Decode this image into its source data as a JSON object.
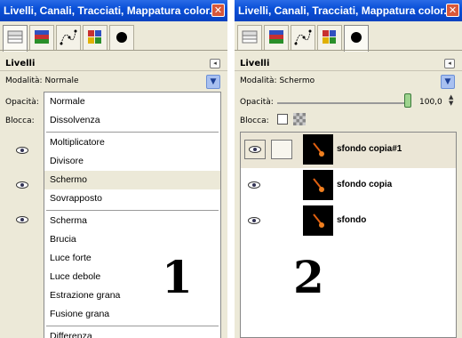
{
  "labels": {
    "panel1_marker": "1",
    "panel2_marker": "2"
  },
  "panel1": {
    "title": "Livelli, Canali, Tracciati, Mappatura color...",
    "section_title": "Livelli",
    "modalita_label": "Modalità:",
    "modalita_value": "Normale",
    "opacita_label": "Opacità:",
    "blocca_label": "Blocca:",
    "dropdown": {
      "items": [
        "Normale",
        "Dissolvenza",
        "Moltiplicatore",
        "Divisore",
        "Schermo",
        "Sovrapposto",
        "Scherma",
        "Brucia",
        "Luce forte",
        "Luce debole",
        "Estrazione grana",
        "Fusione grana",
        "Differenza"
      ],
      "selected": "Schermo"
    }
  },
  "panel2": {
    "title": "Livelli, Canali, Tracciati, Mappatura color...",
    "section_title": "Livelli",
    "modalita_label": "Modalità:",
    "modalita_value": "Schermo",
    "opacita_label": "Opacità:",
    "opacita_value": "100,0",
    "blocca_label": "Blocca:",
    "layers": [
      {
        "name": "sfondo copia#1",
        "visible": true,
        "active": true
      },
      {
        "name": "sfondo copia",
        "visible": true,
        "active": false
      },
      {
        "name": "sfondo",
        "visible": true,
        "active": false
      }
    ]
  },
  "colors": {
    "titlebar": "#0a50d8",
    "selection": "#ece9d8",
    "panel_bg": "#ece9d8"
  },
  "icons": [
    "layers-tab-icon",
    "channels-tab-icon",
    "paths-tab-icon",
    "palette-tab-icon",
    "brush-tab-icon",
    "eye-icon",
    "close-icon",
    "chevron-down-icon",
    "menu-arrow-icon"
  ]
}
